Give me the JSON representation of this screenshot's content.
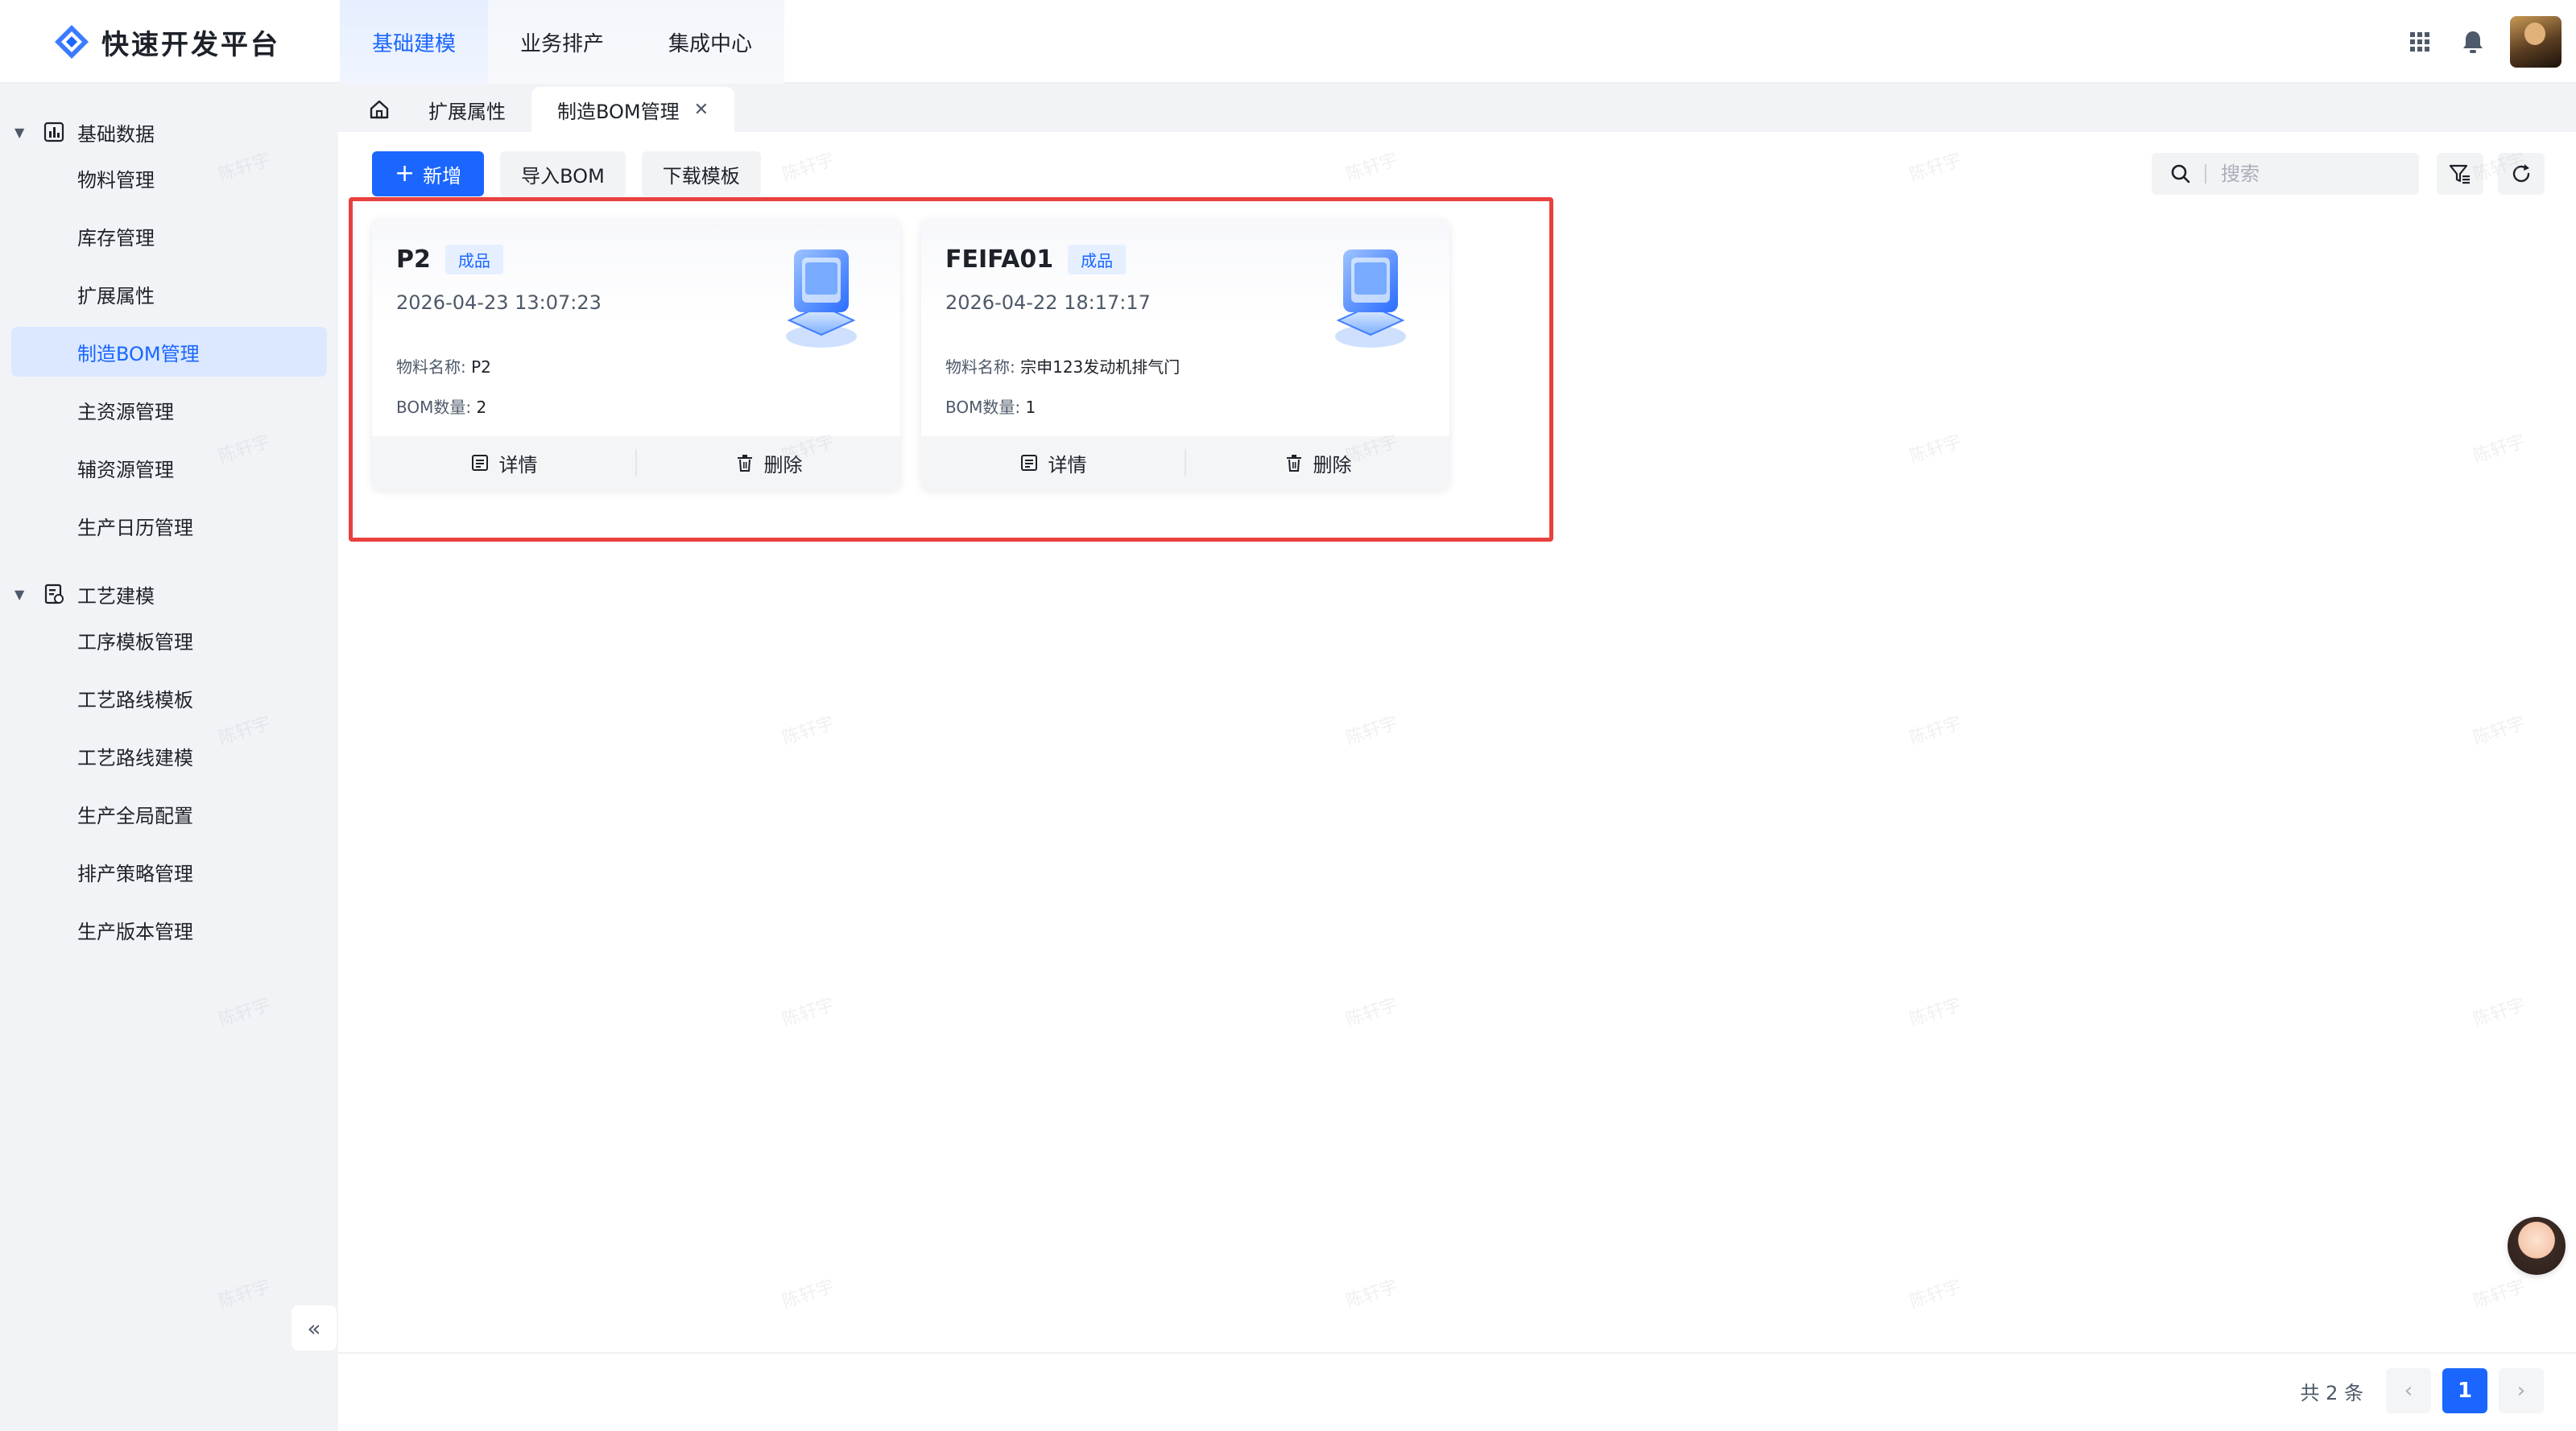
{
  "app": {
    "title": "快速开发平台",
    "accent_color": "#1a66ff",
    "highlight_color": "#e8413f"
  },
  "top_nav": [
    {
      "label": "基础建模",
      "active": true
    },
    {
      "label": "业务排产",
      "active": false
    },
    {
      "label": "集成中心",
      "active": false
    }
  ],
  "top_right": {
    "icons": [
      "apps-grid-icon",
      "bell-icon",
      "user-avatar"
    ]
  },
  "sidebar": {
    "groups": [
      {
        "label": "基础数据",
        "icon": "chart-icon",
        "expanded": true,
        "items": [
          {
            "label": "物料管理",
            "active": false
          },
          {
            "label": "库存管理",
            "active": false
          },
          {
            "label": "扩展属性",
            "active": false
          },
          {
            "label": "制造BOM管理",
            "active": true
          },
          {
            "label": "主资源管理",
            "active": false
          },
          {
            "label": "辅资源管理",
            "active": false
          },
          {
            "label": "生产日历管理",
            "active": false
          }
        ]
      },
      {
        "label": "工艺建模",
        "icon": "process-icon",
        "expanded": true,
        "items": [
          {
            "label": "工序模板管理",
            "active": false
          },
          {
            "label": "工艺路线模板",
            "active": false
          },
          {
            "label": "工艺路线建模",
            "active": false
          },
          {
            "label": "生产全局配置",
            "active": false
          },
          {
            "label": "排产策略管理",
            "active": false
          },
          {
            "label": "生产版本管理",
            "active": false
          }
        ]
      }
    ],
    "collapse_label": "«"
  },
  "tabs": [
    {
      "label": "扩展属性",
      "active": false
    },
    {
      "label": "制造BOM管理",
      "active": true,
      "closable": true
    }
  ],
  "toolbar": {
    "add_label": "新增",
    "import_label": "导入BOM",
    "download_label": "下载模板",
    "search_placeholder": "搜索"
  },
  "cards": [
    {
      "code": "P2",
      "tag": "成品",
      "time": "2026-04-23 13:07:23",
      "material_label": "物料名称:",
      "material_value": "P2",
      "bom_label": "BOM数量:",
      "bom_value": "2",
      "detail_label": "详情",
      "delete_label": "删除"
    },
    {
      "code": "FEIFA01",
      "tag": "成品",
      "time": "2026-04-22 18:17:17",
      "material_label": "物料名称:",
      "material_value": "宗申123发动机排气门",
      "bom_label": "BOM数量:",
      "bom_value": "1",
      "detail_label": "详情",
      "delete_label": "删除"
    }
  ],
  "pagination": {
    "total_text": "共 2 条",
    "current_page": "1",
    "prev": "‹",
    "next": "›"
  },
  "watermark": "陈轩宇"
}
